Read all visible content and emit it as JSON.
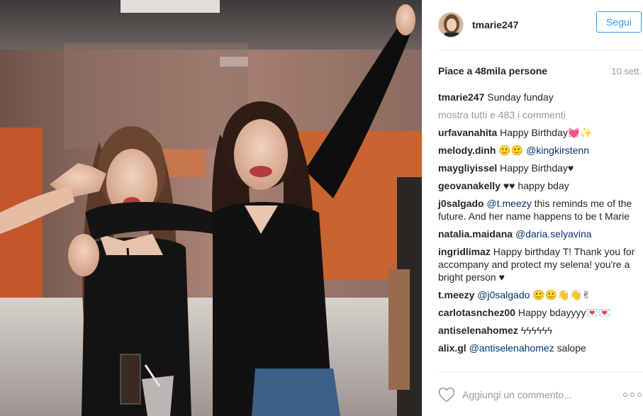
{
  "header": {
    "username": "tmarie247",
    "follow_label": "Segui"
  },
  "meta": {
    "likes": "Piace a 48mila persone",
    "date": "10 sett."
  },
  "caption": {
    "user": "tmarie247",
    "text": "Sunday funday"
  },
  "show_all": "mostra tutti e 483 i commenti",
  "comments": [
    {
      "user": "urfavanahita",
      "text": "Happy Birthday💓✨"
    },
    {
      "user": "melody.dinh",
      "text": "🙂🙂 ",
      "mention": "@kingkirstenn"
    },
    {
      "user": "maygliyissel",
      "text": "Happy Birthday♥"
    },
    {
      "user": "geovanakelly",
      "text": "♥♥ happy bday"
    },
    {
      "user": "j0salgado",
      "mention": "@t.meezy",
      "text": " this reminds me of the future. And her name happens to be t Marie"
    },
    {
      "user": "natalia.maidana",
      "mention": "@daria.selyavina",
      "text": ""
    },
    {
      "user": "ingridlimaz",
      "text": "Happy birthday T! Thank you for accompany and protect my selena! you're a bright person ♥"
    },
    {
      "user": "t.meezy",
      "mention": "@j0salgado",
      "text": " 🙂🙂👋👋✌"
    },
    {
      "user": "carlotasnchez00",
      "text": "Happy bdayyyy💌💌"
    },
    {
      "user": "antiselenahomez",
      "text": "ϟϟϟϟϟϟ"
    },
    {
      "user": "alix.gl",
      "mention": "@antiselenahomez",
      "text": " salope"
    }
  ],
  "footer": {
    "comment_placeholder": "Aggiungi un commento..."
  },
  "colors": {
    "accent": "#3897f0",
    "mention": "#003569",
    "muted": "#999999"
  },
  "icons": {
    "like": "heart-icon",
    "more": "more-options-icon"
  }
}
